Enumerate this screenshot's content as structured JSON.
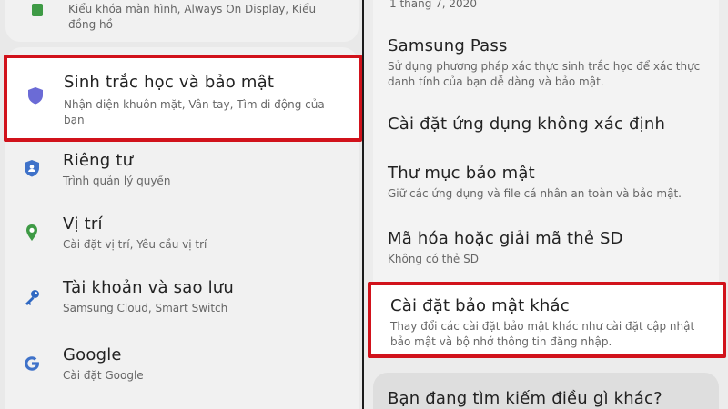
{
  "left": {
    "top_item": {
      "subtitle": "Kiểu khóa màn hình, Always On Display, Kiểu đồng hồ"
    },
    "items": [
      {
        "title": "Sinh trắc học và bảo mật",
        "subtitle": "Nhận diện khuôn mặt, Vân tay, Tìm di động của bạn",
        "icon": "shield-icon",
        "color": "#6b6bd6"
      },
      {
        "title": "Riêng tư",
        "subtitle": "Trình quản lý quyền",
        "icon": "privacy-shield-icon",
        "color": "#3f72c9"
      },
      {
        "title": "Vị trí",
        "subtitle": "Cài đặt vị trí, Yêu cầu vị trí",
        "icon": "location-pin-icon",
        "color": "#3e9a45"
      },
      {
        "title": "Tài khoản và sao lưu",
        "subtitle": "Samsung Cloud, Smart Switch",
        "icon": "key-icon",
        "color": "#2f68c2"
      },
      {
        "title": "Google",
        "subtitle": "Cài đặt Google",
        "icon": "google-icon",
        "color": "#3f72c9"
      }
    ]
  },
  "right": {
    "top_text": "1 tháng 7, 2020",
    "items": [
      {
        "title": "Samsung Pass",
        "subtitle": "Sử dụng phương pháp xác thực sinh trắc học để xác thực danh tính của bạn dễ dàng và bảo mật."
      },
      {
        "title": "Cài đặt ứng dụng không xác định",
        "subtitle": ""
      },
      {
        "title": "Thư mục bảo mật",
        "subtitle": "Giữ các ứng dụng và file cá nhân an toàn và bảo mật."
      },
      {
        "title": "Mã hóa hoặc giải mã thẻ SD",
        "subtitle": "Không có thẻ SD"
      },
      {
        "title": "Cài đặt bảo mật khác",
        "subtitle": "Thay đổi các cài đặt bảo mật khác như cài đặt cập nhật bảo mật và bộ nhớ thông tin đăng nhập."
      }
    ],
    "bottom_prompt": "Bạn đang tìm kiếm điều gì khác?"
  },
  "colors": {
    "highlight": "#d1121b"
  }
}
